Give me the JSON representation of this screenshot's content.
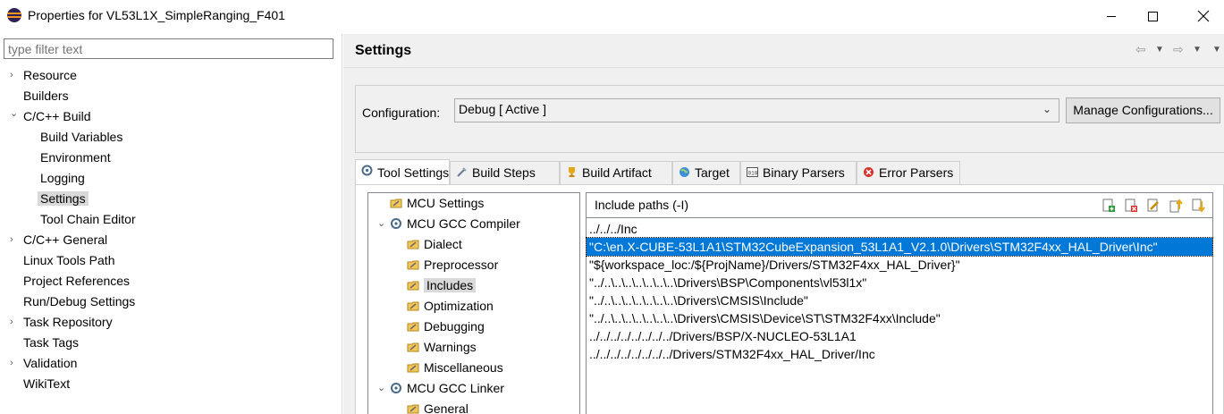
{
  "window": {
    "title": "Properties for VL53L1X_SimpleRanging_F401"
  },
  "left": {
    "filter_placeholder": "type filter text",
    "items": [
      {
        "label": "Resource",
        "twisty": "›"
      },
      {
        "label": "Builders",
        "twisty": ""
      },
      {
        "label": "C/C++ Build",
        "twisty": "⌄"
      },
      {
        "label": "Build Variables",
        "twisty": ""
      },
      {
        "label": "Environment",
        "twisty": ""
      },
      {
        "label": "Logging",
        "twisty": ""
      },
      {
        "label": "Settings",
        "twisty": ""
      },
      {
        "label": "Tool Chain Editor",
        "twisty": ""
      },
      {
        "label": "C/C++ General",
        "twisty": "›"
      },
      {
        "label": "Linux Tools Path",
        "twisty": ""
      },
      {
        "label": "Project References",
        "twisty": ""
      },
      {
        "label": "Run/Debug Settings",
        "twisty": ""
      },
      {
        "label": "Task Repository",
        "twisty": "›"
      },
      {
        "label": "Task Tags",
        "twisty": ""
      },
      {
        "label": "Validation",
        "twisty": "›"
      },
      {
        "label": "WikiText",
        "twisty": ""
      }
    ]
  },
  "right": {
    "title": "Settings",
    "configuration_label": "Configuration:",
    "configuration_value": "Debug  [ Active ]",
    "manage_button": "Manage Configurations...",
    "tabs": [
      {
        "label": "Tool Settings",
        "icon": "tool-settings-icon"
      },
      {
        "label": "Build Steps",
        "icon": "build-steps-icon"
      },
      {
        "label": "Build Artifact",
        "icon": "build-artifact-icon"
      },
      {
        "label": "Target",
        "icon": "target-icon"
      },
      {
        "label": "Binary Parsers",
        "icon": "binary-parsers-icon"
      },
      {
        "label": "Error Parsers",
        "icon": "error-parsers-icon"
      }
    ],
    "tool_tree": [
      {
        "label": "MCU Settings",
        "twisty": ""
      },
      {
        "label": "MCU GCC Compiler",
        "twisty": "⌄"
      },
      {
        "label": "Dialect",
        "twisty": ""
      },
      {
        "label": "Preprocessor",
        "twisty": ""
      },
      {
        "label": "Includes",
        "twisty": ""
      },
      {
        "label": "Optimization",
        "twisty": ""
      },
      {
        "label": "Debugging",
        "twisty": ""
      },
      {
        "label": "Warnings",
        "twisty": ""
      },
      {
        "label": "Miscellaneous",
        "twisty": ""
      },
      {
        "label": "MCU GCC Linker",
        "twisty": "⌄"
      },
      {
        "label": "General",
        "twisty": ""
      }
    ],
    "include_title": "Include paths (-I)",
    "include_paths": [
      "../../../Inc",
      "\"C:\\en.X-CUBE-53L1A1\\STM32CubeExpansion_53L1A1_V2.1.0\\Drivers\\STM32F4xx_HAL_Driver\\Inc\"",
      "\"${workspace_loc:/${ProjName}/Drivers/STM32F4xx_HAL_Driver}\"",
      "\"../..\\..\\..\\..\\..\\..\\..\\Drivers\\BSP\\Components\\vl53l1x\"",
      "\"../..\\..\\..\\..\\..\\..\\..\\Drivers\\CMSIS\\Include\"",
      "\"../..\\..\\..\\..\\..\\..\\..\\Drivers\\CMSIS\\Device\\ST\\STM32F4xx\\Include\"",
      "../../../../../../../../Drivers/BSP/X-NUCLEO-53L1A1",
      "../../../../../../../../Drivers/STM32F4xx_HAL_Driver/Inc"
    ]
  }
}
